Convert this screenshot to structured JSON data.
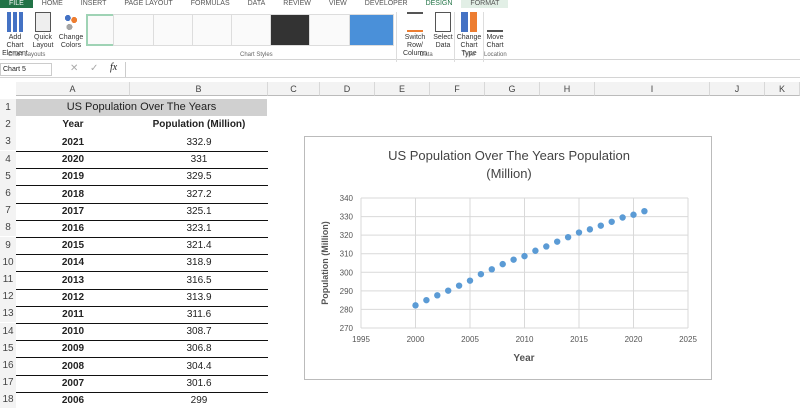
{
  "tabs": [
    "FILE",
    "HOME",
    "INSERT",
    "PAGE LAYOUT",
    "FORMULAS",
    "DATA",
    "REVIEW",
    "VIEW",
    "DEVELOPER",
    "DESIGN",
    "FORMAT"
  ],
  "ribbon": {
    "add_chart_element": "Add Chart Element",
    "quick_layout": "Quick Layout",
    "change_colors": "Change Colors",
    "group_chart_layouts": "Chart Layouts",
    "group_chart_styles": "Chart Styles",
    "switch_row_column": "Switch Row/ Column",
    "select_data": "Select Data",
    "group_data": "Data",
    "change_chart_type": "Change Chart Type",
    "group_type": "Type",
    "move_chart": "Move Chart",
    "group_location": "Location"
  },
  "formula_bar": {
    "name_box": "Chart 5",
    "fx": "fx",
    "value": ""
  },
  "columns": [
    "A",
    "B",
    "C",
    "D",
    "E",
    "F",
    "G",
    "H",
    "I",
    "J",
    "K"
  ],
  "sheet": {
    "title": "US Population Over The Years",
    "header_year": "Year",
    "header_pop": "Population (Million)",
    "rows": [
      [
        "2021",
        "332.9"
      ],
      [
        "2020",
        "331"
      ],
      [
        "2019",
        "329.5"
      ],
      [
        "2018",
        "327.2"
      ],
      [
        "2017",
        "325.1"
      ],
      [
        "2016",
        "323.1"
      ],
      [
        "2015",
        "321.4"
      ],
      [
        "2014",
        "318.9"
      ],
      [
        "2013",
        "316.5"
      ],
      [
        "2012",
        "313.9"
      ],
      [
        "2011",
        "311.6"
      ],
      [
        "2010",
        "308.7"
      ],
      [
        "2009",
        "306.8"
      ],
      [
        "2008",
        "304.4"
      ],
      [
        "2007",
        "301.6"
      ],
      [
        "2006",
        "299"
      ]
    ]
  },
  "chart_data": {
    "type": "scatter",
    "title": "US Population Over The Years Population (Million)",
    "xlabel": "Year",
    "ylabel": "Population (Million)",
    "xlim": [
      1995,
      2025
    ],
    "ylim": [
      270,
      340
    ],
    "xticks": [
      "1995",
      "2000",
      "2005",
      "2010",
      "2015",
      "2020",
      "2025"
    ],
    "yticks": [
      "270",
      "280",
      "290",
      "300",
      "310",
      "320",
      "330",
      "340"
    ],
    "grid": true,
    "color": "#5b9bd5",
    "x": [
      2000,
      2001,
      2002,
      2003,
      2004,
      2005,
      2006,
      2007,
      2008,
      2009,
      2010,
      2011,
      2012,
      2013,
      2014,
      2015,
      2016,
      2017,
      2018,
      2019,
      2020,
      2021
    ],
    "y": [
      282.2,
      285,
      287.6,
      290.1,
      292.8,
      295.5,
      299,
      301.6,
      304.4,
      306.8,
      308.7,
      311.6,
      313.9,
      316.5,
      318.9,
      321.4,
      323.1,
      325.1,
      327.2,
      329.5,
      331,
      332.9
    ]
  }
}
